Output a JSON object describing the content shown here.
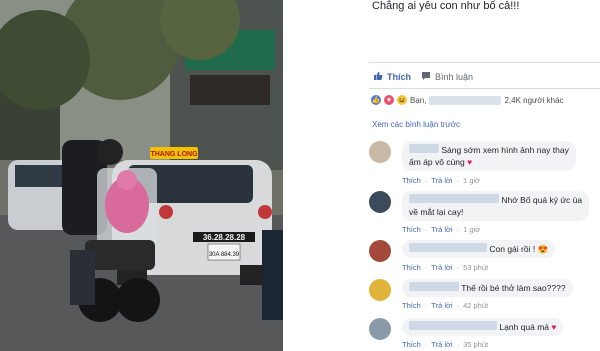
{
  "post": {
    "caption": "Chẳng ai yêu con như bố cả!!!"
  },
  "actions": {
    "like_label": "Thích",
    "comment_label": "Bình luận"
  },
  "reactions": {
    "prefix": "Bạn,",
    "count_text": "2,4K người khác"
  },
  "see_previous": "Xem các bình luận trước",
  "photo": {
    "taxi_sign": "THANG LONG",
    "plate_taxi": "30A 884.39",
    "taxi_phone": "36.28.28.28"
  },
  "comments": [
    {
      "text_line1": "Sáng sớm xem hình ảnh nay thay",
      "text_line2": "ấm áp vô cùng",
      "emoji": "heart",
      "like": "Thích",
      "reply": "Trả lời",
      "time": "1 giờ"
    },
    {
      "text_line1": "Nhớ Bố quá ký ức ùa",
      "text_line2": "về mắt lại cay!",
      "emoji": "",
      "like": "Thích",
      "reply": "Trả lời",
      "time": "1 giờ"
    },
    {
      "text_line1": "Con gái rồi !",
      "text_line2": "",
      "emoji": "heart-eyes",
      "like": "Thích",
      "reply": "Trả lời",
      "time": "53 phút"
    },
    {
      "text_line1": "Thế rồi bé thở làm sao????",
      "text_line2": "",
      "emoji": "",
      "like": "Thích",
      "reply": "Trả lời",
      "time": "42 phút"
    },
    {
      "text_line1": "Lạnh quá má",
      "text_line2": "",
      "emoji": "heart",
      "like": "Thích",
      "reply": "Trả lời",
      "time": "35 phút"
    }
  ]
}
